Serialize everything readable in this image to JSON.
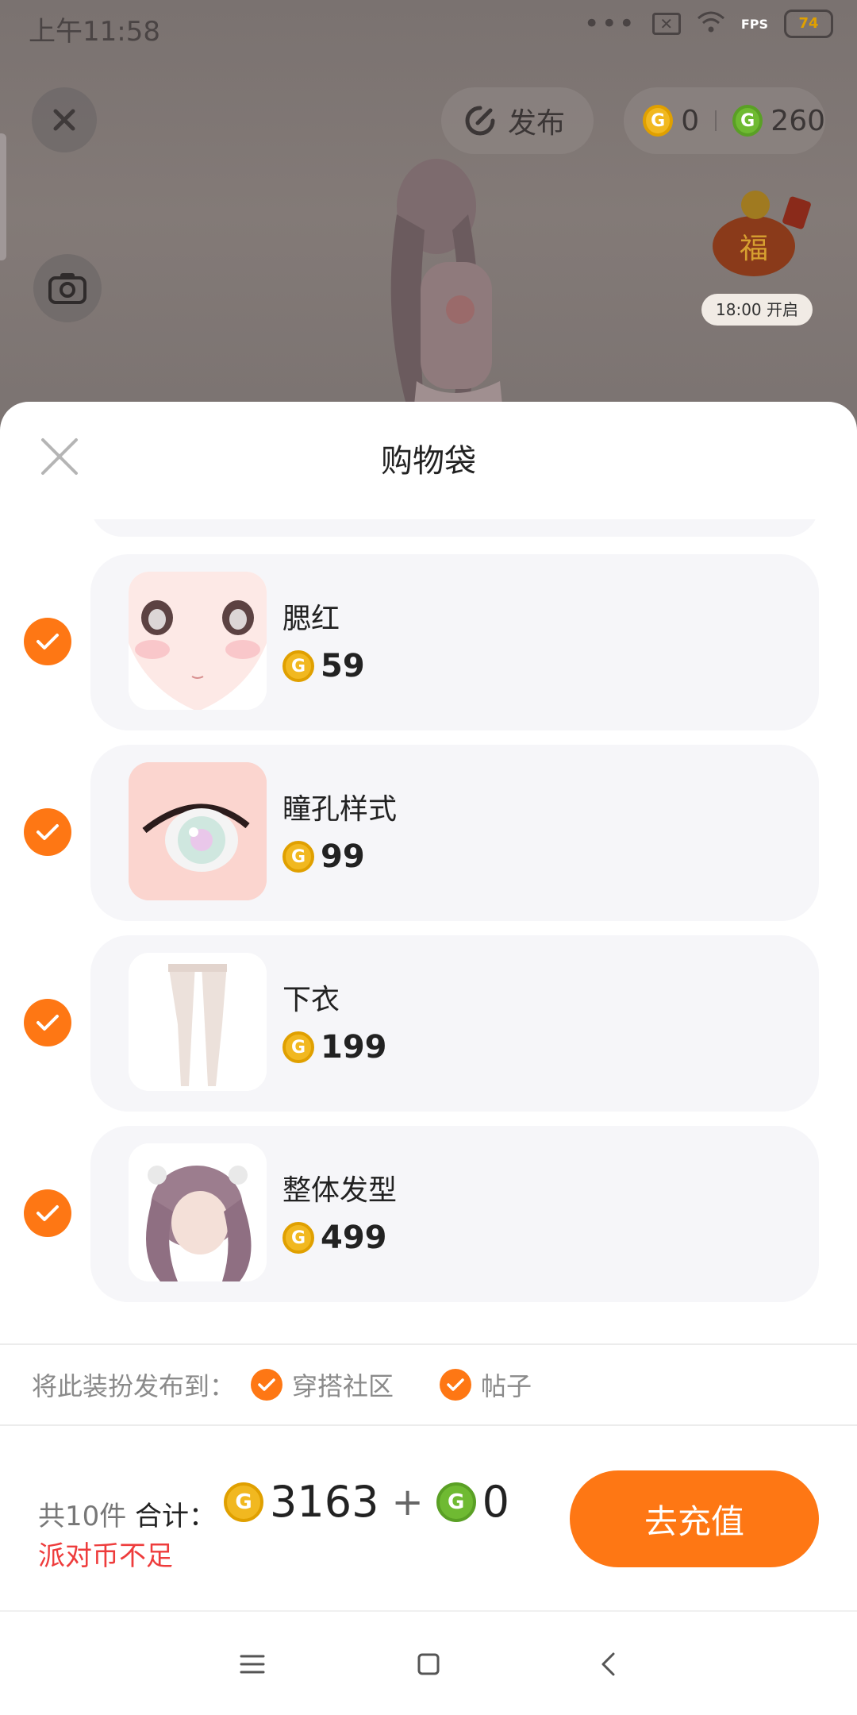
{
  "status_bar": {
    "time": "上午11:58",
    "fps": "FPS",
    "battery": "74"
  },
  "top_bar": {
    "publish_label": "发布",
    "gold_coins": "0",
    "green_coins": "260"
  },
  "event": {
    "badge": "18:00 开启",
    "fu_char": "福"
  },
  "sheet": {
    "title": "购物袋",
    "items": [
      {
        "name": "腮红",
        "price": "59",
        "checked": true,
        "thumb": "blush"
      },
      {
        "name": "瞳孔样式",
        "price": "99",
        "checked": true,
        "thumb": "pupil"
      },
      {
        "name": "下衣",
        "price": "199",
        "checked": true,
        "thumb": "legwear"
      },
      {
        "name": "整体发型",
        "price": "499",
        "checked": true,
        "thumb": "hair"
      }
    ]
  },
  "publish_to": {
    "label": "将此装扮发布到：",
    "options": [
      {
        "label": "穿搭社区",
        "checked": true
      },
      {
        "label": "帖子",
        "checked": true
      }
    ]
  },
  "footer": {
    "count": "共10件",
    "total_label": "合计：",
    "gold_total": "3163",
    "plus": "+",
    "green_total": "0",
    "warning": "派对币不足",
    "recharge_label": "去充值"
  },
  "colors": {
    "accent": "#fe7714",
    "warning": "#ee3c3c",
    "gold": "#f1b820",
    "green": "#6fba32"
  }
}
